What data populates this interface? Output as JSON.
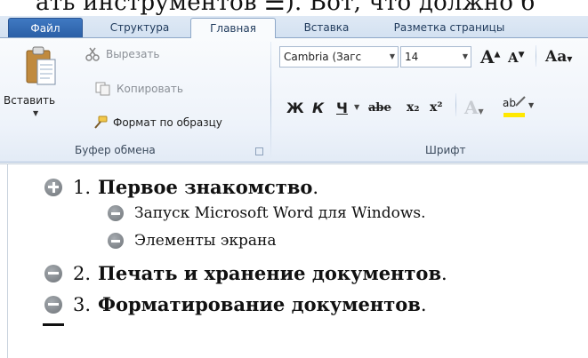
{
  "top_cut_text": "ать инструментов ☰). Вот, что должно б",
  "tabs": [
    {
      "label": "Файл"
    },
    {
      "label": "Структура"
    },
    {
      "label": "Главная"
    },
    {
      "label": "Вставка"
    },
    {
      "label": "Разметка страницы"
    }
  ],
  "clipboard": {
    "paste_label": "Вставить",
    "cut_label": "Вырезать",
    "copy_label": "Копировать",
    "format_painter_label": "Формат по образцу",
    "group_label": "Буфер обмена"
  },
  "font": {
    "font_name": "Cambria (Загс",
    "font_size": "14",
    "grow_label": "A",
    "shrink_label": "A",
    "case_label": "Aa",
    "bold_label": "Ж",
    "italic_label": "К",
    "underline_label": "Ч",
    "strike_label": "abe",
    "subscript_label": "x₂",
    "superscript_label": "x²",
    "highlight_label": "ab",
    "effects_label": "A",
    "group_label": "Шрифт"
  },
  "document": {
    "items": [
      {
        "number": "1.",
        "text": "Первое знакомство",
        "suffix": "."
      },
      {
        "text": "Запуск Microsoft Word для Windows."
      },
      {
        "text": "Элементы экрана"
      },
      {
        "number": "2.",
        "text": "Печать и хранение документов",
        "suffix": "."
      },
      {
        "number": "3.",
        "text": "Форматирование документов",
        "suffix": "."
      }
    ]
  },
  "colors": {
    "file_tab": "#2b5fa6",
    "ribbon_bg": "#eef3fa",
    "bullet": "#7a7f84"
  }
}
